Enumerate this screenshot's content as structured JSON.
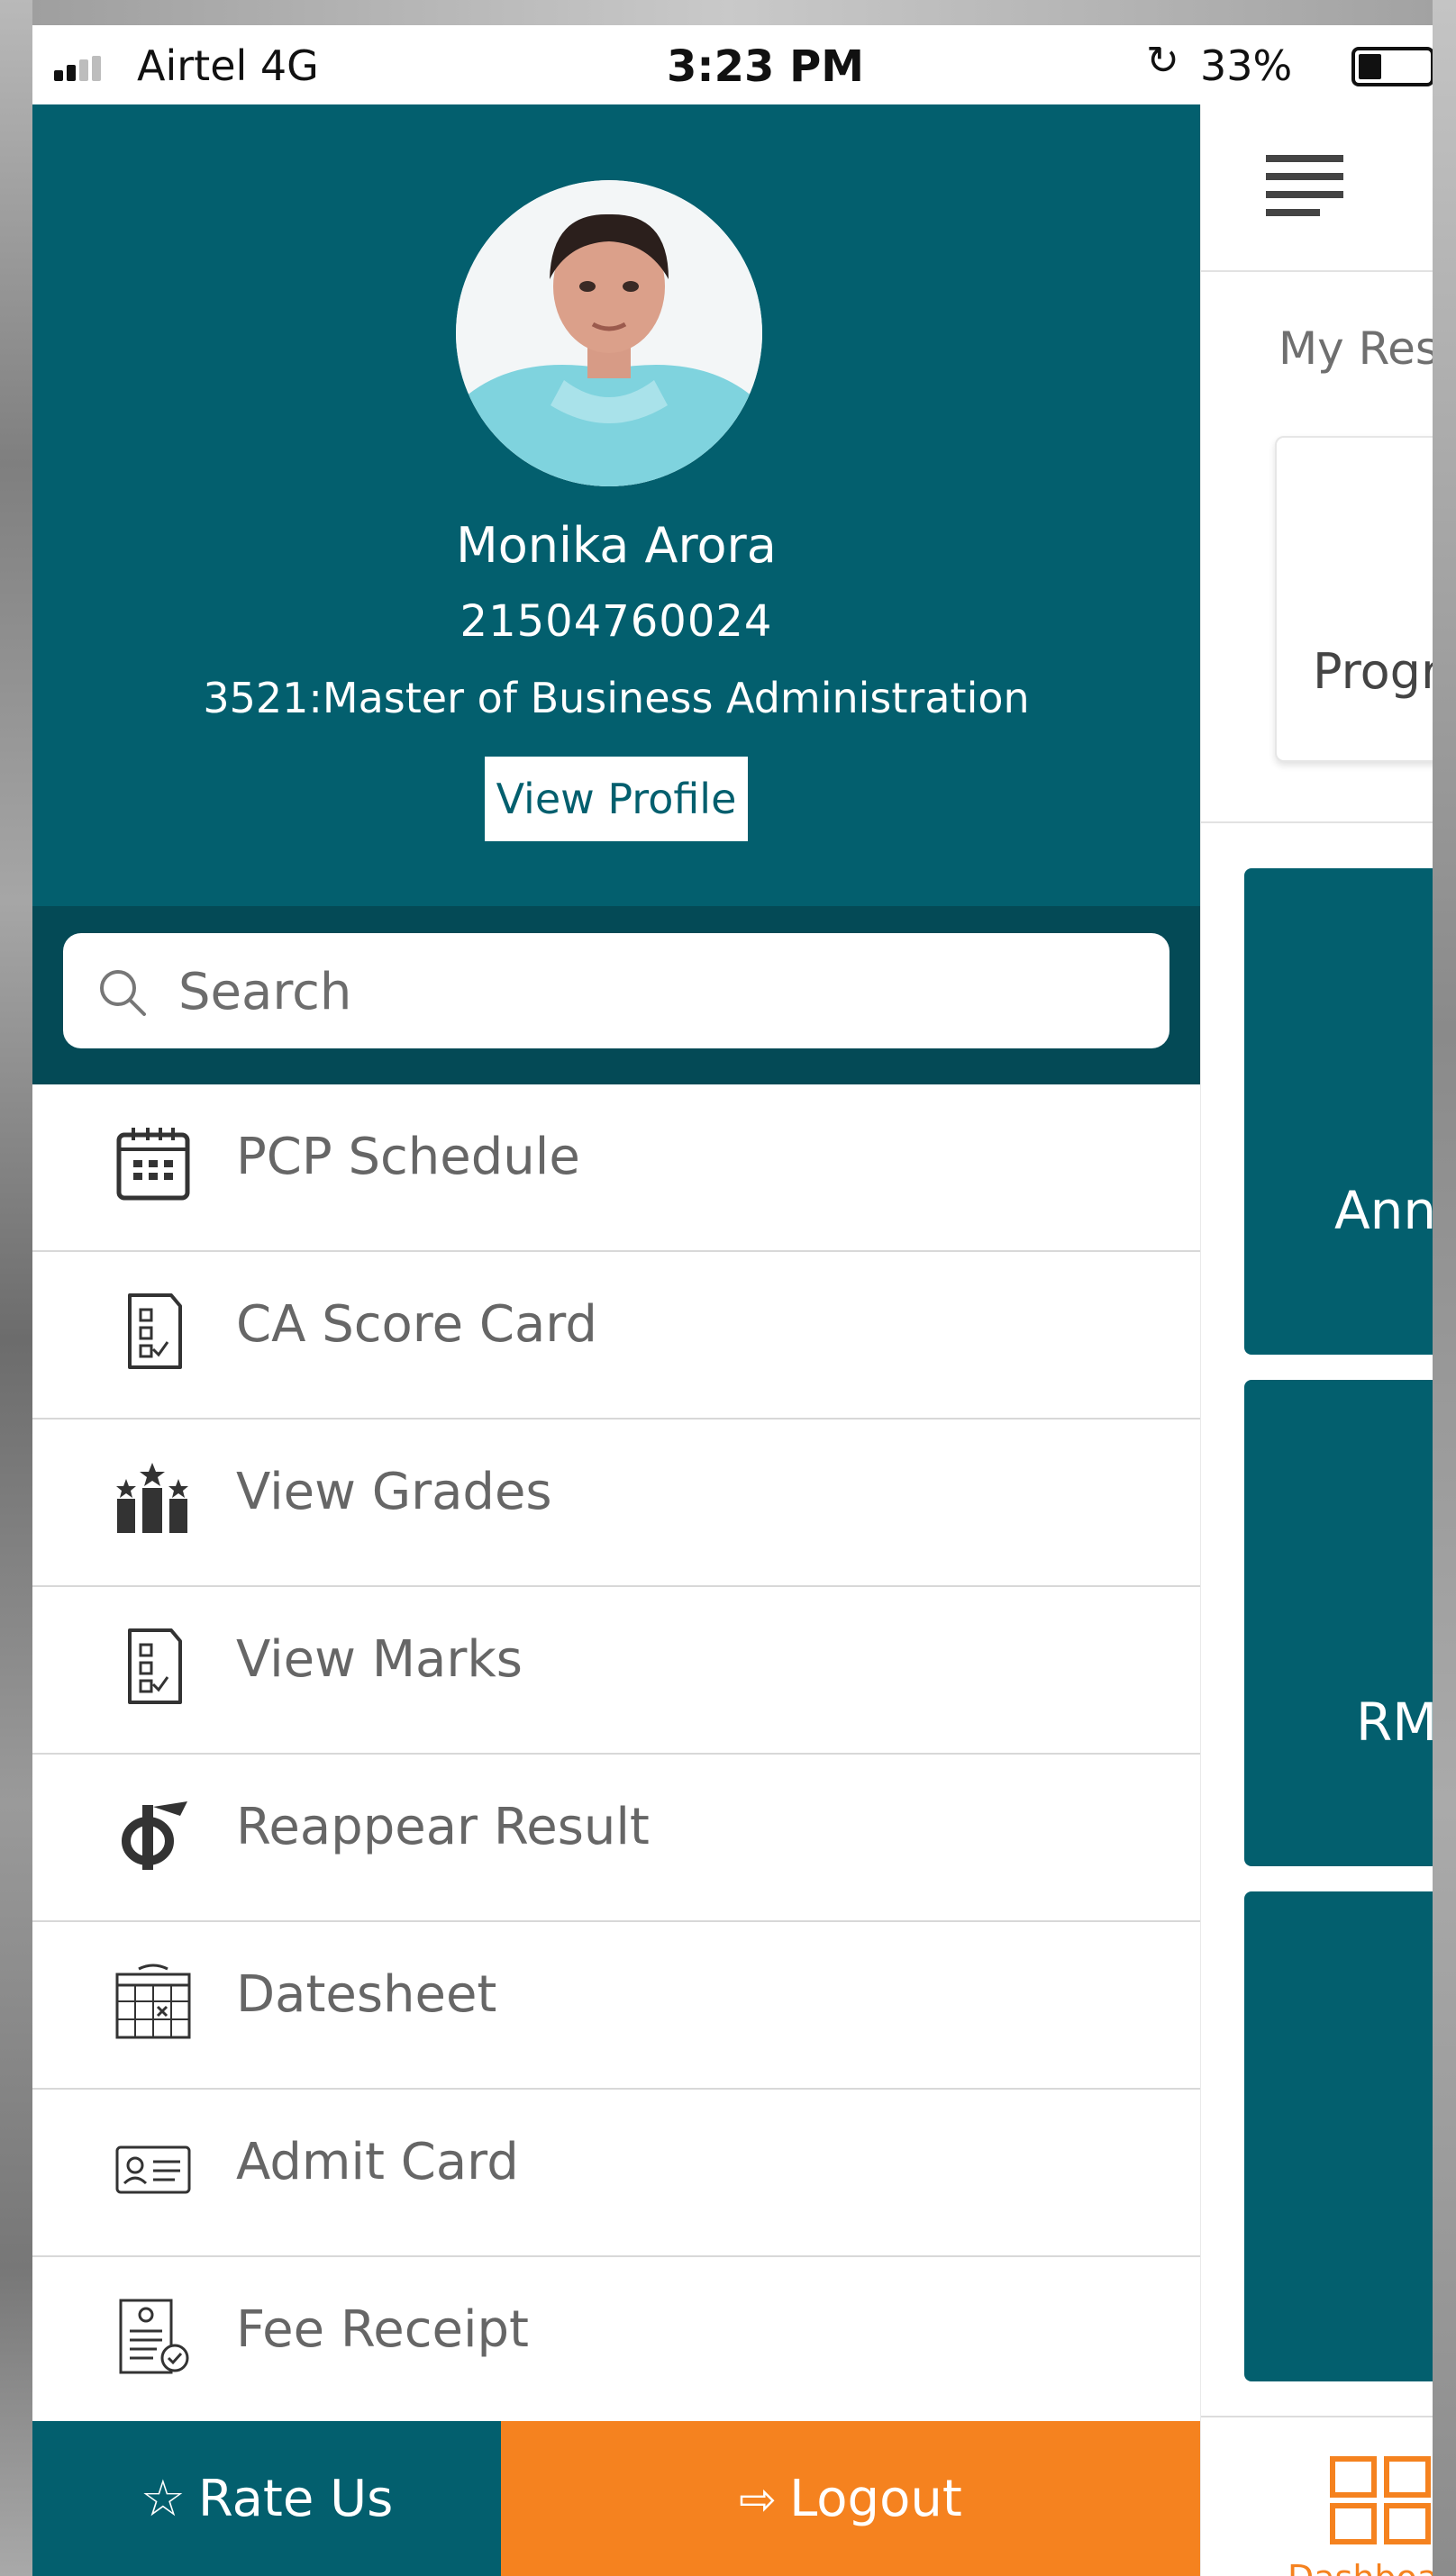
{
  "status_bar": {
    "carrier": "Airtel  4G",
    "time": "3:23 PM",
    "battery": "33%",
    "battery_level": 0.33
  },
  "profile": {
    "name": "Monika Arora",
    "id": "21504760024",
    "program": "3521:Master of Business Administration",
    "view_profile_label": "View Profile"
  },
  "search": {
    "placeholder": "Search"
  },
  "menu": {
    "items": [
      {
        "label": "PCP Schedule",
        "icon": "calendar-icon"
      },
      {
        "label": "CA Score Card",
        "icon": "checklist-icon"
      },
      {
        "label": "View Grades",
        "icon": "grades-stars-icon"
      },
      {
        "label": "View Marks",
        "icon": "checklist-icon"
      },
      {
        "label": "Reappear Result",
        "icon": "reappear-icon"
      },
      {
        "label": "Datesheet",
        "icon": "datesheet-icon"
      },
      {
        "label": "Admit Card",
        "icon": "id-card-icon"
      },
      {
        "label": "Fee Receipt",
        "icon": "receipt-icon"
      }
    ]
  },
  "footer": {
    "rate_label": "Rate Us",
    "logout_label": "Logout"
  },
  "main": {
    "section_title": "My Res",
    "program_card_label": "Progr",
    "tiles": [
      {
        "label": "Ann"
      },
      {
        "label": "RM"
      },
      {
        "label": ""
      }
    ],
    "bottom_nav": {
      "dashboard_label": "Dashboard"
    }
  },
  "colors": {
    "teal": "#035f6e",
    "dark_teal": "#044a56",
    "orange": "#f5821f",
    "menu_text": "#666666"
  }
}
